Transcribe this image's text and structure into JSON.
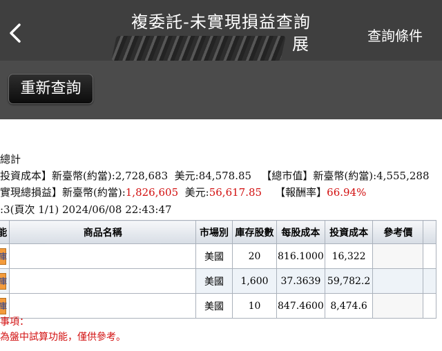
{
  "header": {
    "title_line1": "複委託-未實現損益查詢",
    "title_line2": "展",
    "query_conditions": "查詢條件"
  },
  "toolbar": {
    "requery_label": "重新查詢"
  },
  "summary": {
    "heading": "總計",
    "cost_label": "投資成本】新臺幣(約當):",
    "cost_twd": "2,728,683",
    "cost_usd_label": "美元:",
    "cost_usd": "84,578.85",
    "mv_label": "【總市值】新臺幣(約當):",
    "mv_twd": "4,555,288",
    "pl_label": "實現總損益】新臺幣(約當):",
    "pl_twd": "1,826,605",
    "pl_usd_label": "美元:",
    "pl_usd": "56,617.85",
    "roi_label": "【報酬率】",
    "roi": "66.94%",
    "page_info": ":3(頁次 1/1) 2024/06/08 22:43:47"
  },
  "table": {
    "headers": [
      "能",
      "商品名稱",
      "市場別",
      "庫存股數",
      "每股成本",
      "投資成本",
      "參考價"
    ],
    "rows": [
      {
        "action": "庫",
        "market": "美國",
        "shares": "20",
        "unit_cost": "816.1000",
        "cost": "16,322"
      },
      {
        "action": "庫",
        "market": "美國",
        "shares": "1,600",
        "unit_cost": "37.3639",
        "cost": "59,782.2"
      },
      {
        "action": "庫",
        "market": "美國",
        "shares": "10",
        "unit_cost": "847.4600",
        "cost": "8,474.6"
      }
    ]
  },
  "notes": {
    "line1": "事項：",
    "line2": "為盤中試算功能，僅供參考。"
  }
}
